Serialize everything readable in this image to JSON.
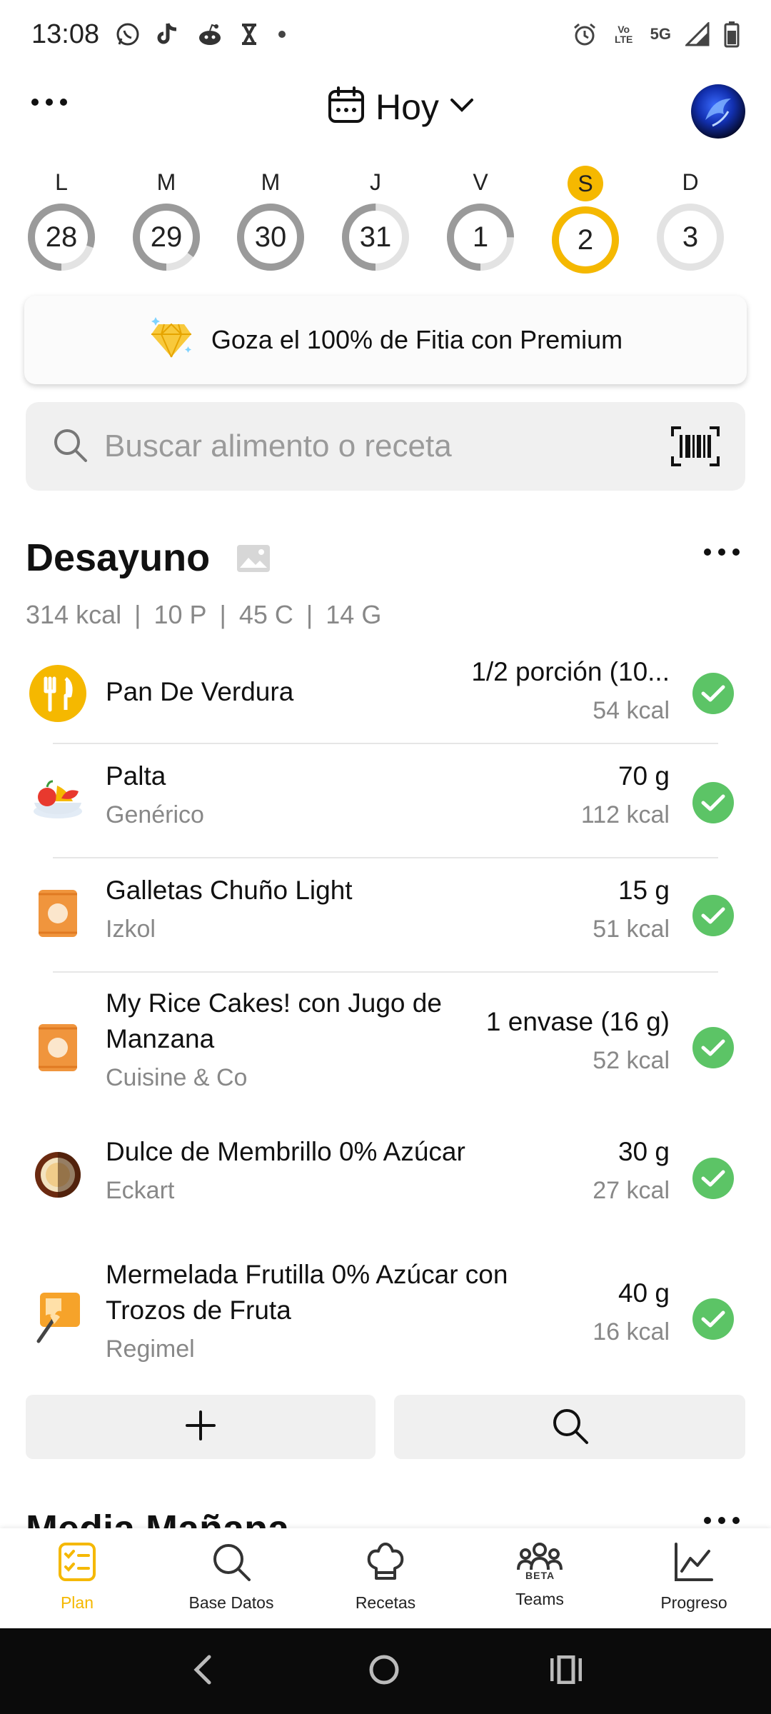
{
  "status_bar": {
    "time": "13:08",
    "network": "5G",
    "volte": "Vo LTE"
  },
  "header": {
    "date_label": "Hoy"
  },
  "week": [
    {
      "letter": "L",
      "day": "28",
      "active": false,
      "progress": 0.8
    },
    {
      "letter": "M",
      "day": "29",
      "active": false,
      "progress": 0.85
    },
    {
      "letter": "M",
      "day": "30",
      "active": false,
      "progress": 1.0
    },
    {
      "letter": "J",
      "day": "31",
      "active": false,
      "progress": 0.5
    },
    {
      "letter": "V",
      "day": "1",
      "active": false,
      "progress": 0.75
    },
    {
      "letter": "S",
      "day": "2",
      "active": true,
      "progress": 1.0
    },
    {
      "letter": "D",
      "day": "3",
      "active": false,
      "progress": 0.0
    }
  ],
  "premium_banner": {
    "text": "Goza el 100% de Fitia con Premium"
  },
  "search": {
    "placeholder": "Buscar alimento o receta"
  },
  "meal": {
    "title": "Desayuno",
    "macros": {
      "kcal": "314 kcal",
      "protein": "10 P",
      "carbs": "45 C",
      "fat": "14 G"
    },
    "foods": [
      {
        "name": "Pan De Verdura",
        "brand": "",
        "quantity": "1/2 porción (10...",
        "kcal": "54 kcal",
        "icon": "fork-knife-icon",
        "checked": true
      },
      {
        "name": "Palta",
        "brand": "Genérico",
        "quantity": "70 g",
        "kcal": "112 kcal",
        "icon": "fruit-bowl-icon",
        "checked": true
      },
      {
        "name": "Galletas Chuño Light",
        "brand": "Izkol",
        "quantity": "15 g",
        "kcal": "51 kcal",
        "icon": "packaged-food-icon",
        "checked": true
      },
      {
        "name": "My Rice Cakes! con Jugo de Manzana",
        "brand": "Cuisine & Co",
        "quantity": "1 envase (16 g)",
        "kcal": "52 kcal",
        "icon": "packaged-food-icon",
        "checked": true
      },
      {
        "name": "Dulce de Membrillo 0% Azúcar",
        "brand": "Eckart",
        "quantity": "30 g",
        "kcal": "27 kcal",
        "icon": "condiment-icon",
        "checked": true
      },
      {
        "name": "Mermelada Frutilla 0% Azúcar con Trozos de Fruta",
        "brand": "Regimel",
        "quantity": "40 g",
        "kcal": "16 kcal",
        "icon": "spread-icon",
        "checked": true
      }
    ]
  },
  "next_meal": {
    "title": "Media Mañana"
  },
  "bottom_nav": [
    {
      "label": "Plan",
      "icon": "plan-icon",
      "active": true
    },
    {
      "label": "Base Datos",
      "icon": "search-icon",
      "active": false
    },
    {
      "label": "Recetas",
      "icon": "chef-hat-icon",
      "active": false
    },
    {
      "label": "Teams",
      "icon": "teams-icon",
      "active": false
    },
    {
      "label": "Progreso",
      "icon": "chart-icon",
      "active": false
    }
  ],
  "teams_badge": "BETA",
  "colors": {
    "accent": "#f5b800",
    "check": "#5cc466",
    "ring_gray": "#9a9a9a",
    "ring_track": "#e3e3e3"
  }
}
